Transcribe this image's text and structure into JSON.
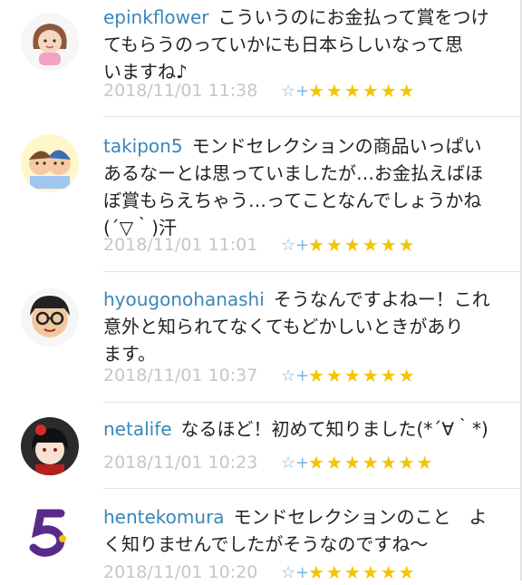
{
  "comments": [
    {
      "username": "epinkflower",
      "text_lines": [
        "こういうのにお金払って賞をつけ",
        "てもらうのっていかにも日本らしいなって思",
        "いますね♪"
      ],
      "timestamp": "2018/11/01 11:38",
      "stars": "★★★★★★",
      "fav_icon": "☆+"
    },
    {
      "username": "takipon5",
      "text_lines": [
        "モンドセレクションの商品いっぱい",
        "あるなーとは思っていましたが…お金払えばほ",
        "ぼ賞もらえちゃう…ってことなんでしょうかね",
        "(´▽｀)汗"
      ],
      "timestamp": "2018/11/01 11:01",
      "stars": "★★★★★★",
      "fav_icon": "☆+"
    },
    {
      "username": "hyougonohanashi",
      "text_lines": [
        "そうなんですよねー！これ",
        "意外と知られてなくてもどかしいときがあり",
        "ます。"
      ],
      "timestamp": "2018/11/01 10:37",
      "stars": "★★★★★★",
      "fav_icon": "☆+"
    },
    {
      "username": "netalife",
      "text_lines": [
        "なるほど！初めて知りました(*´∀｀*)"
      ],
      "timestamp": "2018/11/01 10:23",
      "stars": "★★★★★★★",
      "fav_icon": "☆+"
    },
    {
      "username": "hentekomura",
      "text_lines": [
        "モンドセレクションのこと　よ",
        "く知りませんでしたがそうなのですね〜"
      ],
      "timestamp": "2018/11/01 10:20",
      "stars": "★★★★★★",
      "fav_icon": "☆+"
    }
  ]
}
